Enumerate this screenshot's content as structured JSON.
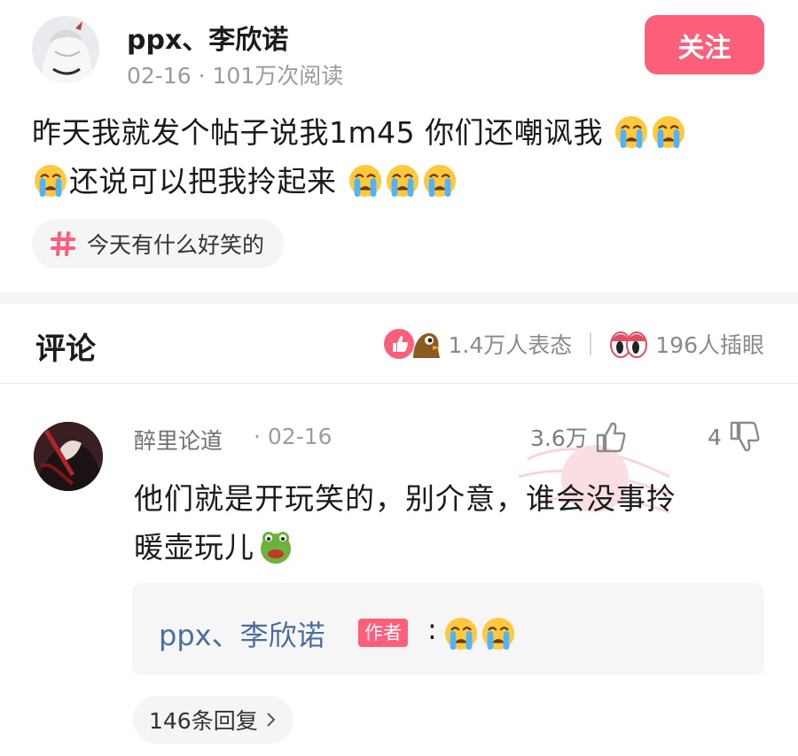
{
  "post": {
    "author": "ppx、李欣诺",
    "date": "02-16",
    "views": "101万次阅读",
    "follow_label": "关注",
    "text_line1": "昨天我就发个帖子说我1m45 你们还嘲讽我",
    "text_line2": "还说可以把我拎起来",
    "topic": "今天有什么好笑的"
  },
  "comments_section": {
    "title": "评论",
    "reactions_count": "1.4万人表态",
    "eye_count": "196人插眼"
  },
  "comment": {
    "user": "醉里论道",
    "date": "02-16",
    "likes": "3.6万",
    "dislikes": "4",
    "text_line1": "他们就是开玩笑的，别介意，谁会没事拎",
    "text_line2": "暖壶玩儿",
    "reply": {
      "author": "ppx、李欣诺",
      "badge": "作者",
      "colon": ":"
    },
    "more_replies": "146条回复"
  },
  "colors": {
    "accent": "#fd5e7a",
    "link": "#4b6e9c",
    "muted": "#9a9a9a"
  },
  "icons": [
    "crying-emoji",
    "hash-icon",
    "like-reaction-icon",
    "eyes-icon",
    "thumb-up-icon",
    "thumb-down-icon",
    "frog-emoji",
    "chevron-right-icon"
  ]
}
